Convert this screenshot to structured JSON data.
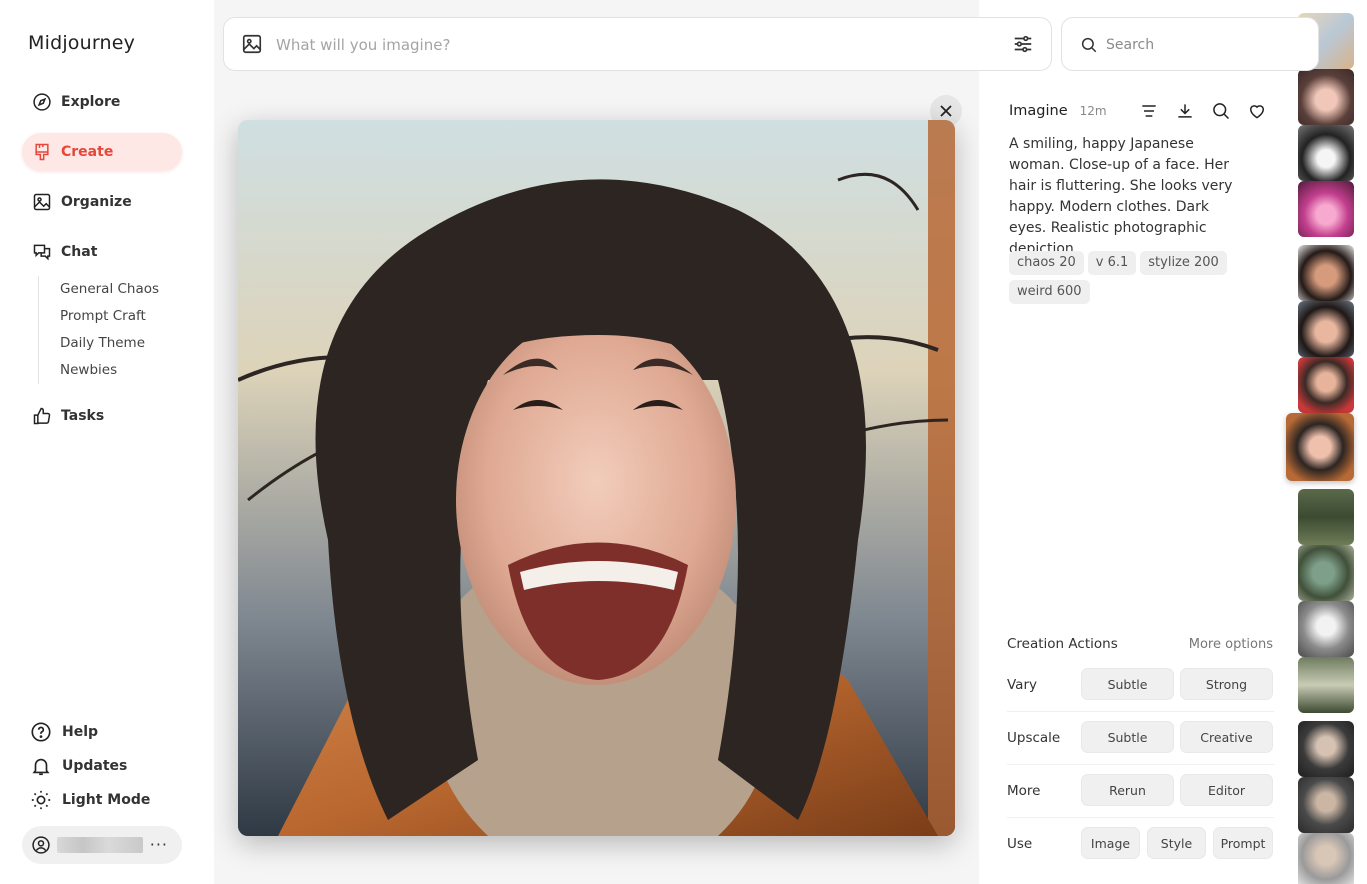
{
  "app": {
    "title": "Midjourney"
  },
  "nav": [
    {
      "label": "Explore",
      "icon": "compass-icon"
    },
    {
      "label": "Create",
      "icon": "brush-icon",
      "active": true
    },
    {
      "label": "Organize",
      "icon": "image-icon"
    },
    {
      "label": "Chat",
      "icon": "chat-bubbles-icon"
    },
    {
      "label": "Tasks",
      "icon": "thumbs-up-icon"
    }
  ],
  "chat_channels": [
    "General Chaos",
    "Prompt Craft",
    "Daily Theme",
    "Newbies"
  ],
  "bottom_nav": [
    {
      "label": "Help",
      "icon": "question-circle-icon"
    },
    {
      "label": "Updates",
      "icon": "bell-icon"
    },
    {
      "label": "Light Mode",
      "icon": "sun-icon"
    }
  ],
  "user": {
    "menu": "···"
  },
  "prompt": {
    "placeholder": "What will you imagine?"
  },
  "search": {
    "placeholder": "Search"
  },
  "detail": {
    "type": "Imagine",
    "time": "12m",
    "prompt": "A smiling, happy Japanese woman. Close-up of a face. Her hair is fluttering. She looks very happy. Modern clothes. Dark eyes. Realistic photographic depiction.",
    "params": [
      "chaos 20",
      "v 6.1",
      "stylize 200",
      "weird 600"
    ]
  },
  "creation_actions": {
    "title": "Creation Actions",
    "more": "More options",
    "rows": [
      {
        "label": "Vary",
        "buttons": [
          "Subtle",
          "Strong"
        ]
      },
      {
        "label": "Upscale",
        "buttons": [
          "Subtle",
          "Creative"
        ]
      },
      {
        "label": "More",
        "buttons": [
          "Rerun",
          "Editor"
        ]
      },
      {
        "label": "Use",
        "buttons": [
          "Image",
          "Style",
          "Prompt"
        ]
      }
    ]
  },
  "colors": {
    "accent": "#e5473a",
    "accent_bg": "#fde8e6"
  }
}
